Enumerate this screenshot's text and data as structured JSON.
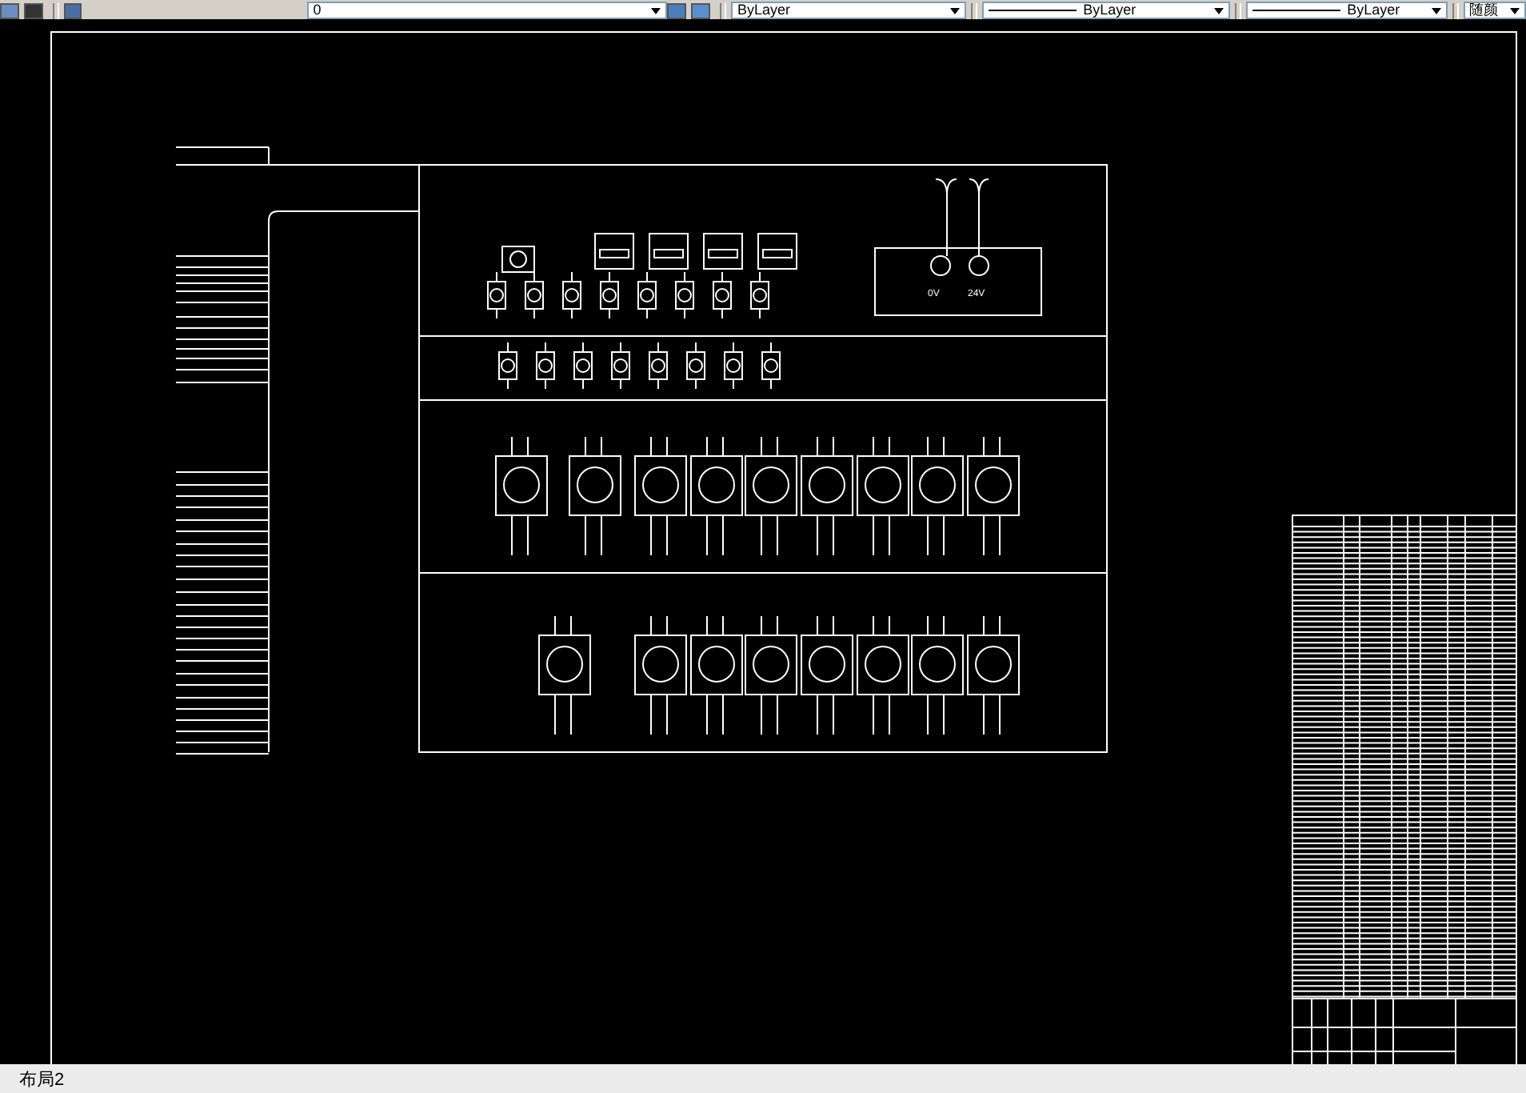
{
  "toolbar": {
    "layer_dropdown": {
      "value": "0"
    },
    "color_dropdown": {
      "value": "ByLayer"
    },
    "linetype_dropdown": {
      "value": "ByLayer"
    },
    "lineweight_dropdown": {
      "value": "ByLayer"
    },
    "plot_style_dropdown": {
      "value": "随颜"
    }
  },
  "drawing": {
    "power_labels": [
      "0V",
      "24V"
    ]
  },
  "layout_tabs": [
    "布局2"
  ]
}
